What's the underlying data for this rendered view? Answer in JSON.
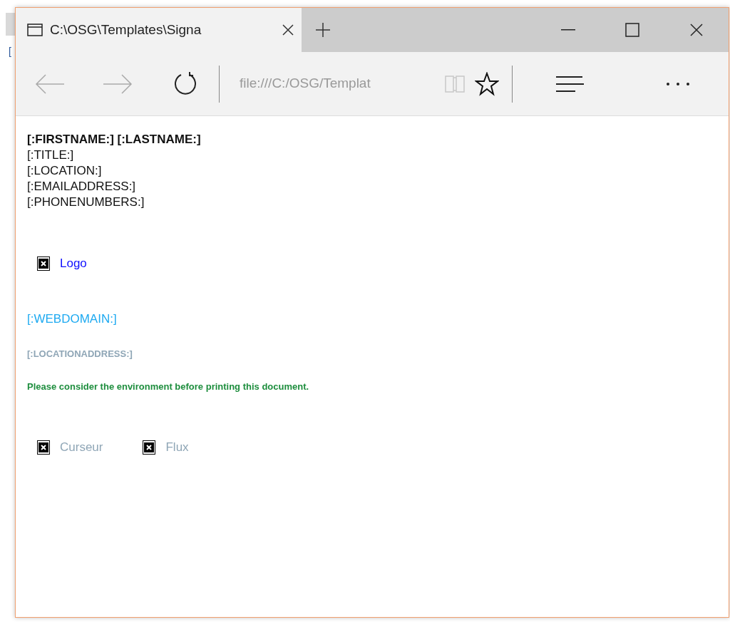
{
  "background_text": "[",
  "tab": {
    "title": "C:\\OSG\\Templates\\Signa",
    "selected": true
  },
  "address_bar": {
    "value": "file:///C:/OSG/Templat"
  },
  "document": {
    "name_line": "[:FIRSTNAME:] [:LASTNAME:]",
    "fields": [
      "[:TITLE:]",
      "[:LOCATION:]",
      "[:EMAILADDRESS:]",
      "[:PHONENUMBERS:]"
    ],
    "logo": {
      "alt": "Logo"
    },
    "web_domain": "[:WEBDOMAIN:]",
    "location_address": "[:LOCATIONADDRESS:]",
    "print_notice": "Please consider the environment before printing this document.",
    "footer_images": [
      {
        "alt": "Curseur"
      },
      {
        "alt": "Flux"
      }
    ]
  }
}
